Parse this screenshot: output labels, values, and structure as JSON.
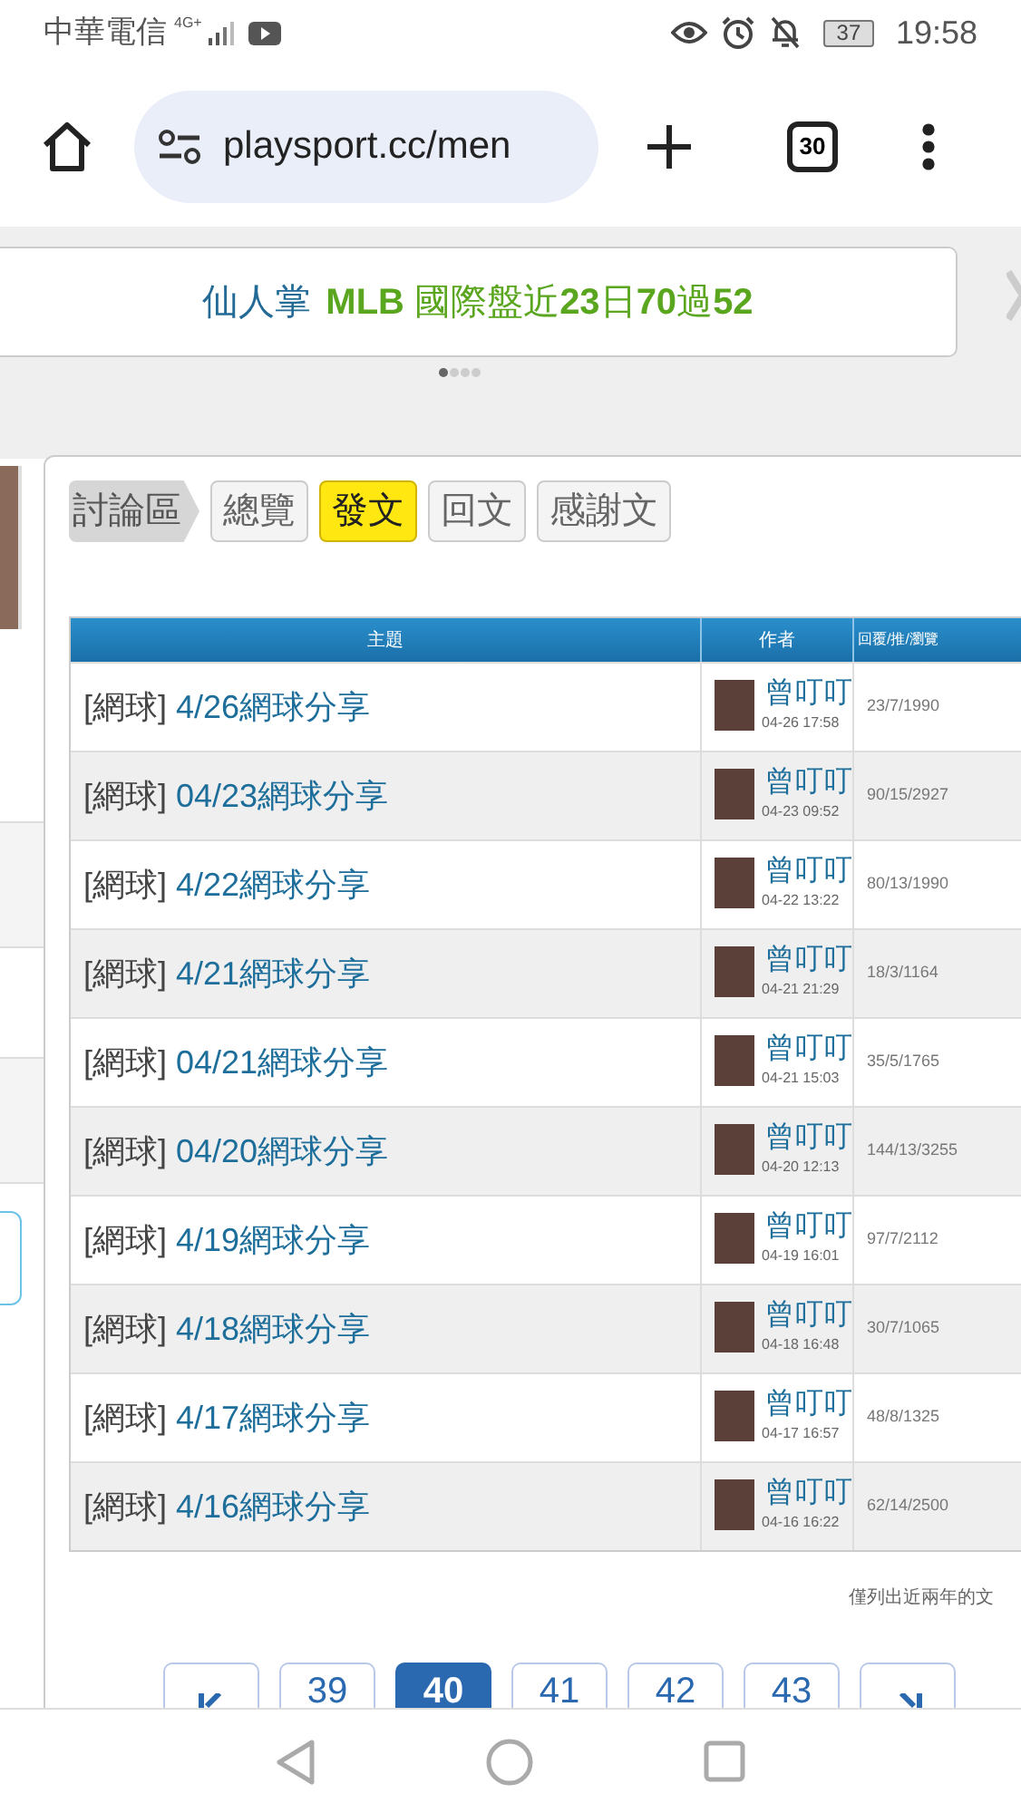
{
  "status_bar": {
    "carrier": "中華電信",
    "network": "4G+",
    "battery": "37",
    "time": "19:58"
  },
  "browser": {
    "url": "playsport.cc/men",
    "tab_count": "30"
  },
  "banner": {
    "name": "仙人掌",
    "record": "**MLB** 國際盤近**23**日**70**過**52**"
  },
  "carousel_dots": [
    {
      "selected": true
    },
    {
      "selected": false
    },
    {
      "selected": false
    },
    {
      "selected": false
    }
  ],
  "breadcrumb": "討論區",
  "tabs": [
    {
      "label": "總覽",
      "selected": false
    },
    {
      "label": "發文",
      "selected": true
    },
    {
      "label": "回文",
      "selected": false
    },
    {
      "label": "感謝文",
      "selected": false
    }
  ],
  "table": {
    "columns": [
      "主題",
      "作者",
      "回覆/推/瀏覽"
    ],
    "rows": [
      {
        "category": "[網球]",
        "title": "4/26網球分享",
        "author": "曾叮叮",
        "time": "04-26 17:58",
        "stats": "23/7/1990"
      },
      {
        "category": "[網球]",
        "title": "04/23網球分享",
        "author": "曾叮叮",
        "time": "04-23 09:52",
        "stats": "90/15/2927"
      },
      {
        "category": "[網球]",
        "title": "4/22網球分享",
        "author": "曾叮叮",
        "time": "04-22 13:22",
        "stats": "80/13/1990"
      },
      {
        "category": "[網球]",
        "title": "4/21網球分享",
        "author": "曾叮叮",
        "time": "04-21 21:29",
        "stats": "18/3/1164"
      },
      {
        "category": "[網球]",
        "title": "04/21網球分享",
        "author": "曾叮叮",
        "time": "04-21 15:03",
        "stats": "35/5/1765"
      },
      {
        "category": "[網球]",
        "title": "04/20網球分享",
        "author": "曾叮叮",
        "time": "04-20 12:13",
        "stats": "144/13/3255"
      },
      {
        "category": "[網球]",
        "title": "4/19網球分享",
        "author": "曾叮叮",
        "time": "04-19 16:01",
        "stats": "97/7/2112"
      },
      {
        "category": "[網球]",
        "title": "4/18網球分享",
        "author": "曾叮叮",
        "time": "04-18 16:48",
        "stats": "30/7/1065"
      },
      {
        "category": "[網球]",
        "title": "4/17網球分享",
        "author": "曾叮叮",
        "time": "04-17 16:57",
        "stats": "48/8/1325"
      },
      {
        "category": "[網球]",
        "title": "4/16網球分享",
        "author": "曾叮叮",
        "time": "04-16 16:22",
        "stats": "62/14/2500"
      }
    ]
  },
  "note": "僅列出近兩年的文",
  "pagination": [
    {
      "kind": "first"
    },
    {
      "kind": "page",
      "label": "39",
      "selected": false
    },
    {
      "kind": "page",
      "label": "40",
      "selected": true
    },
    {
      "kind": "page",
      "label": "41",
      "selected": false
    },
    {
      "kind": "page",
      "label": "42",
      "selected": false
    },
    {
      "kind": "page",
      "label": "43",
      "selected": false
    },
    {
      "kind": "last"
    }
  ]
}
